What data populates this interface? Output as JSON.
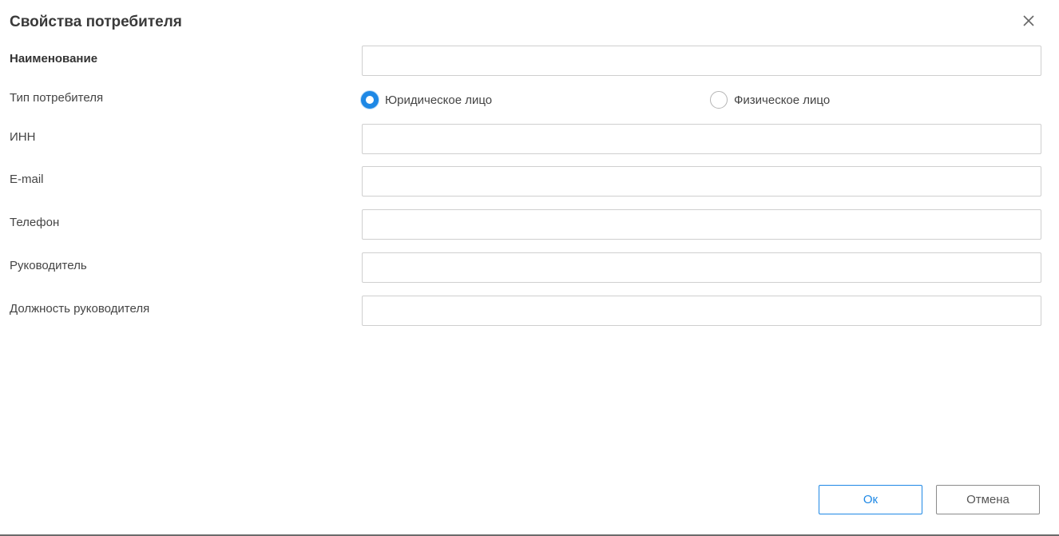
{
  "dialog": {
    "title": "Свойства потребителя",
    "close_icon": "close-icon"
  },
  "form": {
    "name_label": "Наименование",
    "name_value": "",
    "type_label": "Тип потребителя",
    "type_options": [
      {
        "label": "Юридическое лицо",
        "checked": true
      },
      {
        "label": "Физическое лицо",
        "checked": false
      }
    ],
    "inn_label": "ИНН",
    "inn_value": "",
    "email_label": "E-mail",
    "email_value": "",
    "phone_label": "Телефон",
    "phone_value": "",
    "head_label": "Руководитель",
    "head_value": "",
    "head_position_label": "Должность руководителя",
    "head_position_value": ""
  },
  "buttons": {
    "ok_label": "Ок",
    "cancel_label": "Отмена"
  },
  "colors": {
    "accent": "#1e88e5",
    "border": "#cfcfcf"
  }
}
